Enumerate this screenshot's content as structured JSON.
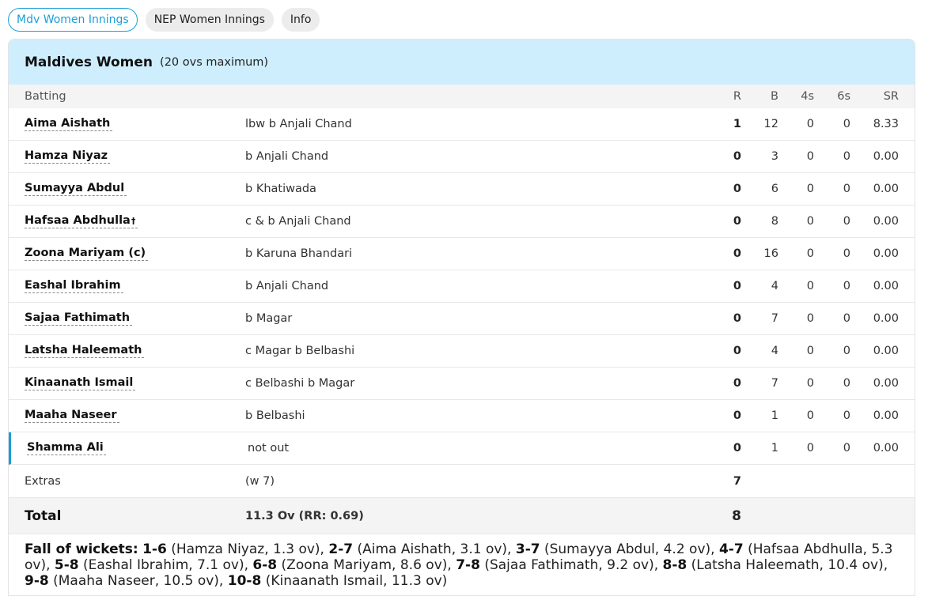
{
  "tabs": [
    {
      "label": "Mdv Women Innings",
      "active": true
    },
    {
      "label": "NEP Women Innings",
      "active": false
    },
    {
      "label": "Info",
      "active": false
    }
  ],
  "innings": {
    "team": "Maldives Women",
    "note": "(20 ovs maximum)",
    "columns": {
      "batting": "Batting",
      "r": "R",
      "b": "B",
      "fours": "4s",
      "sixes": "6s",
      "sr": "SR"
    },
    "batters": [
      {
        "name": "Aima Aishath",
        "dismissal": "lbw b Anjali Chand",
        "r": "1",
        "b": "12",
        "fours": "0",
        "sixes": "0",
        "sr": "8.33"
      },
      {
        "name": "Hamza Niyaz",
        "dismissal": "b Anjali Chand",
        "r": "0",
        "b": "3",
        "fours": "0",
        "sixes": "0",
        "sr": "0.00"
      },
      {
        "name": "Sumayya Abdul",
        "dismissal": "b Khatiwada",
        "r": "0",
        "b": "6",
        "fours": "0",
        "sixes": "0",
        "sr": "0.00"
      },
      {
        "name": "Hafsaa Abdhulla",
        "mark": "†",
        "dismissal": "c & b Anjali Chand",
        "r": "0",
        "b": "8",
        "fours": "0",
        "sixes": "0",
        "sr": "0.00"
      },
      {
        "name": "Zoona Mariyam (c)",
        "dismissal": "b Karuna Bhandari",
        "r": "0",
        "b": "16",
        "fours": "0",
        "sixes": "0",
        "sr": "0.00"
      },
      {
        "name": "Eashal Ibrahim",
        "dismissal": "b Anjali Chand",
        "r": "0",
        "b": "4",
        "fours": "0",
        "sixes": "0",
        "sr": "0.00"
      },
      {
        "name": "Sajaa Fathimath",
        "dismissal": "b Magar",
        "r": "0",
        "b": "7",
        "fours": "0",
        "sixes": "0",
        "sr": "0.00"
      },
      {
        "name": "Latsha Haleemath",
        "dismissal": "c Magar b Belbashi",
        "r": "0",
        "b": "4",
        "fours": "0",
        "sixes": "0",
        "sr": "0.00"
      },
      {
        "name": "Kinaanath Ismail",
        "dismissal": "c Belbashi b Magar",
        "r": "0",
        "b": "7",
        "fours": "0",
        "sixes": "0",
        "sr": "0.00"
      },
      {
        "name": "Maaha Naseer",
        "dismissal": "b Belbashi",
        "r": "0",
        "b": "1",
        "fours": "0",
        "sixes": "0",
        "sr": "0.00"
      },
      {
        "name": "Shamma Ali",
        "dismissal": "not out",
        "r": "0",
        "b": "1",
        "fours": "0",
        "sixes": "0",
        "sr": "0.00",
        "active": true
      }
    ],
    "extras": {
      "label": "Extras",
      "detail": "(w 7)",
      "value": "7"
    },
    "total": {
      "label": "Total",
      "detail": "11.3 Ov (RR: 0.69)",
      "value": "8"
    },
    "fall_of_wickets": {
      "label": "Fall of wickets:",
      "items": [
        {
          "score": "1-6",
          "detail": "(Hamza Niyaz, 1.3 ov)"
        },
        {
          "score": "2-7",
          "detail": "(Aima Aishath, 3.1 ov)"
        },
        {
          "score": "3-7",
          "detail": "(Sumayya Abdul, 4.2 ov)"
        },
        {
          "score": "4-7",
          "detail": "(Hafsaa Abdhulla, 5.3 ov)"
        },
        {
          "score": "5-8",
          "detail": "(Eashal Ibrahim, 7.1 ov)"
        },
        {
          "score": "6-8",
          "detail": "(Zoona Mariyam, 8.6 ov)"
        },
        {
          "score": "7-8",
          "detail": "(Sajaa Fathimath, 9.2 ov)"
        },
        {
          "score": "8-8",
          "detail": "(Latsha Haleemath, 10.4 ov)"
        },
        {
          "score": "9-8",
          "detail": "(Maaha Naseer, 10.5 ov)"
        },
        {
          "score": "10-8",
          "detail": "(Kinaanath Ismail, 11.3 ov)"
        }
      ]
    }
  },
  "colors": {
    "accent": "#1a9fd6",
    "header_bg": "#cfeefd",
    "row_alt_bg": "#f4f4f4"
  }
}
